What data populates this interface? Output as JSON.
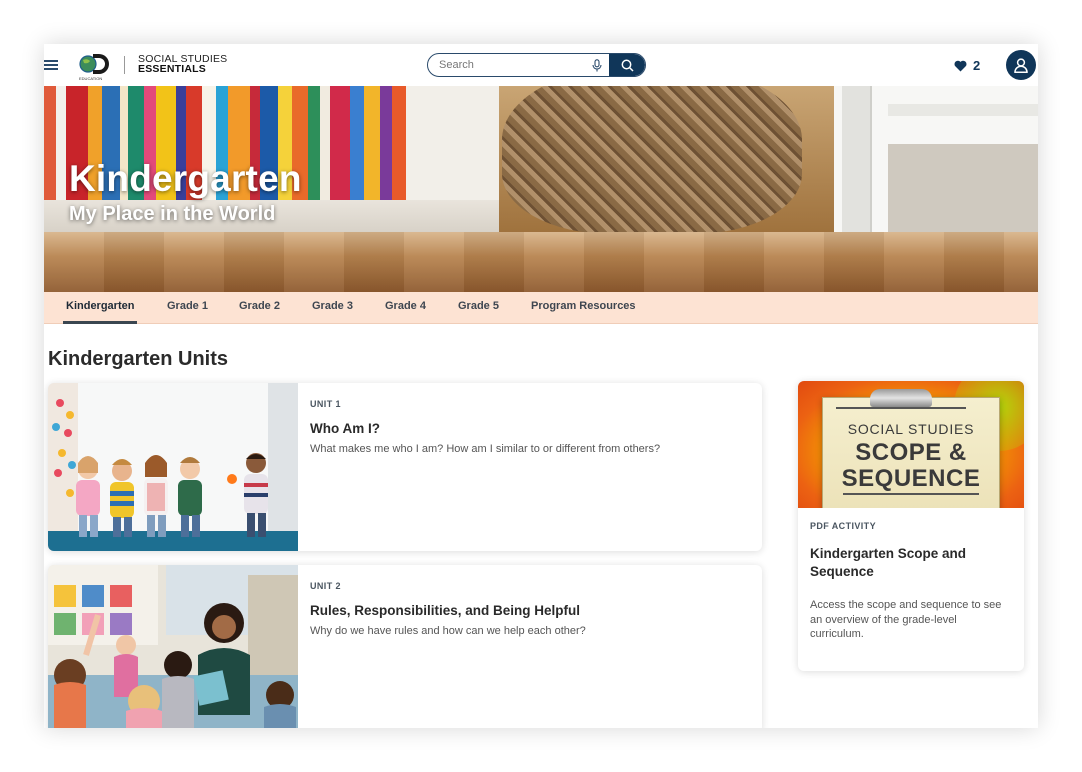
{
  "header": {
    "brand_top": "SOCIAL STUDIES",
    "brand_bottom": "ESSENTIALS",
    "logo_small": "EDUCATION",
    "search_placeholder": "Search",
    "favorites_count": "2",
    "icons": {
      "menu": "hamburger-icon",
      "logo": "discovery-education-logo",
      "mic": "microphone-icon",
      "search": "search-icon",
      "favorites": "heart-icon",
      "account": "user-icon"
    },
    "colors": {
      "navy": "#103659"
    }
  },
  "hero": {
    "title": "Kindergarten",
    "subtitle": "My Place in the World"
  },
  "tabs": [
    {
      "label": "Kindergarten",
      "active": true
    },
    {
      "label": "Grade 1",
      "active": false
    },
    {
      "label": "Grade 2",
      "active": false
    },
    {
      "label": "Grade 3",
      "active": false
    },
    {
      "label": "Grade 4",
      "active": false
    },
    {
      "label": "Grade 5",
      "active": false
    },
    {
      "label": "Program Resources",
      "active": false
    }
  ],
  "section": {
    "title": "Kindergarten Units"
  },
  "units": [
    {
      "label": "UNIT 1",
      "title": "Who Am I?",
      "description": "What makes me who I am? How am I similar to or different from others?"
    },
    {
      "label": "UNIT 2",
      "title": "Rules, Responsibilities, and Being Helpful",
      "description": "Why do we have rules and how can we help each other?"
    }
  ],
  "resource": {
    "image_text": {
      "line1": "SOCIAL STUDIES",
      "line2": "SCOPE &",
      "line3": "SEQUENCE"
    },
    "label": "PDF ACTIVITY",
    "title": "Kindergarten Scope and Sequence",
    "description": "Access the scope and sequence to see an overview of the grade-level curriculum."
  }
}
